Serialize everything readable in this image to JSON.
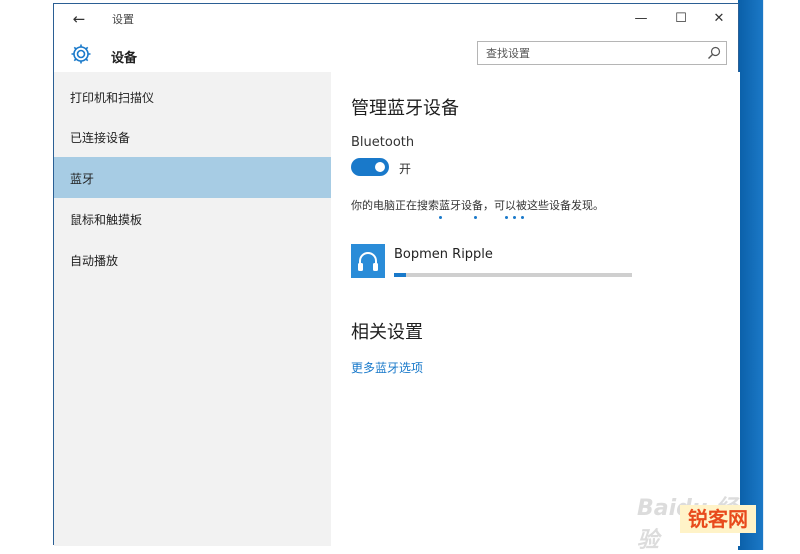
{
  "window": {
    "title": "设置",
    "back_glyph": "←",
    "minimize_glyph": "—",
    "maximize_glyph": "☐",
    "close_glyph": "✕"
  },
  "header": {
    "title": "设备",
    "search_placeholder": "查找设置",
    "icon": "gear-icon"
  },
  "sidebar": {
    "items": [
      {
        "label": "打印机和扫描仪",
        "active": false
      },
      {
        "label": "已连接设备",
        "active": false
      },
      {
        "label": "蓝牙",
        "active": true
      },
      {
        "label": "鼠标和触摸板",
        "active": false
      },
      {
        "label": "自动播放",
        "active": false
      }
    ]
  },
  "main": {
    "title": "管理蓝牙设备",
    "bluetooth_label": "Bluetooth",
    "toggle_state": "开",
    "toggle_on": true,
    "scan_text": "你的电脑正在搜索蓝牙设备，可以被这些设备发现。",
    "device": {
      "name": "Bopmen Ripple",
      "icon": "headset-icon",
      "progress_percent": 5
    },
    "related_title": "相关设置",
    "more_link": "更多蓝牙选项"
  },
  "watermarks": {
    "baidu": "Baidu 经验",
    "ruike": "锐客网"
  },
  "colors": {
    "accent": "#1979ca",
    "selected_nav": "#a7cce4",
    "sidebar_bg": "#f2f2f2"
  }
}
